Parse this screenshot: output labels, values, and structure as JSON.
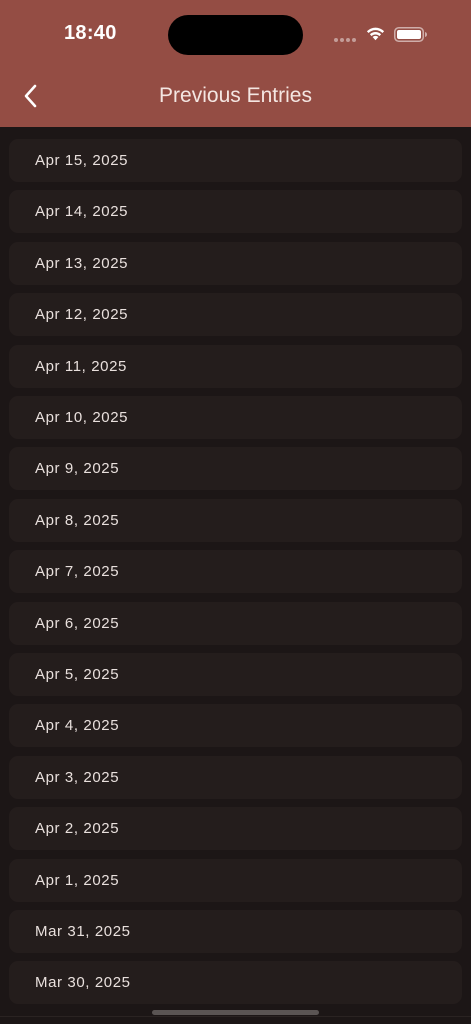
{
  "status_bar": {
    "time": "18:40",
    "icons": [
      "signal-dots-icon",
      "wifi-icon",
      "battery-icon"
    ]
  },
  "header": {
    "title": "Previous Entries",
    "back_icon": "chevron-left-icon"
  },
  "colors": {
    "header_bg": "#944d44",
    "page_bg": "#1c1616",
    "row_bg": "#241d1c",
    "row_text": "#e9e0dd"
  },
  "entries": [
    {
      "label": "Apr 15, 2025"
    },
    {
      "label": "Apr 14, 2025"
    },
    {
      "label": "Apr 13, 2025"
    },
    {
      "label": "Apr 12, 2025"
    },
    {
      "label": "Apr 11, 2025"
    },
    {
      "label": "Apr 10, 2025"
    },
    {
      "label": "Apr 9, 2025"
    },
    {
      "label": "Apr 8, 2025"
    },
    {
      "label": "Apr 7, 2025"
    },
    {
      "label": "Apr 6, 2025"
    },
    {
      "label": "Apr 5, 2025"
    },
    {
      "label": "Apr 4, 2025"
    },
    {
      "label": "Apr 3, 2025"
    },
    {
      "label": "Apr 2, 2025"
    },
    {
      "label": "Apr 1, 2025"
    },
    {
      "label": "Mar 31, 2025"
    },
    {
      "label": "Mar 30, 2025"
    }
  ]
}
